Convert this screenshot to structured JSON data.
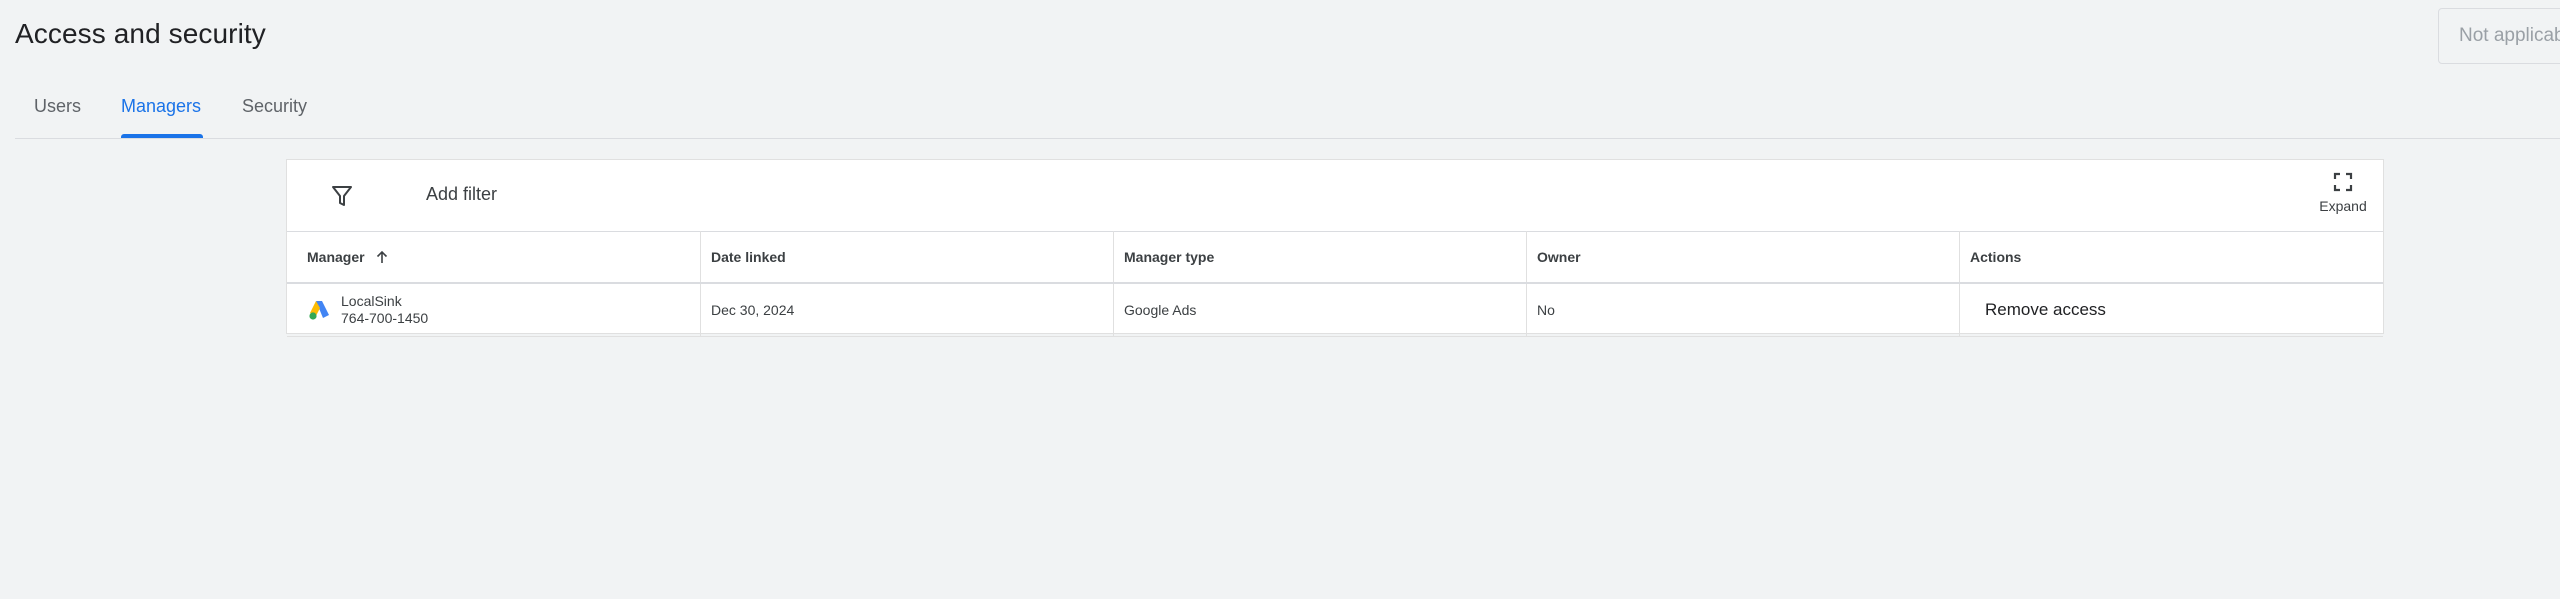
{
  "header": {
    "title": "Access and security",
    "status_button": "Not applicab"
  },
  "tabs": [
    {
      "label": "Users",
      "active": false
    },
    {
      "label": "Managers",
      "active": true
    },
    {
      "label": "Security",
      "active": false
    }
  ],
  "toolbar": {
    "add_filter_label": "Add filter",
    "expand_label": "Expand",
    "filter_icon": "filter-icon",
    "expand_icon": "fullscreen-icon"
  },
  "table": {
    "columns": [
      "Manager",
      "Date linked",
      "Manager type",
      "Owner",
      "Actions"
    ],
    "sort_icon": "arrow-up-icon",
    "rows": [
      {
        "manager_name": "LocalSink",
        "manager_id": "764-700-1450",
        "logo": "google-ads-logo",
        "date_linked": "Dec 30, 2024",
        "manager_type": "Google Ads",
        "owner": "No",
        "action": "Remove access"
      }
    ]
  },
  "colors": {
    "accent": "#1a73e8",
    "background": "#f1f3f4",
    "surface": "#ffffff"
  }
}
